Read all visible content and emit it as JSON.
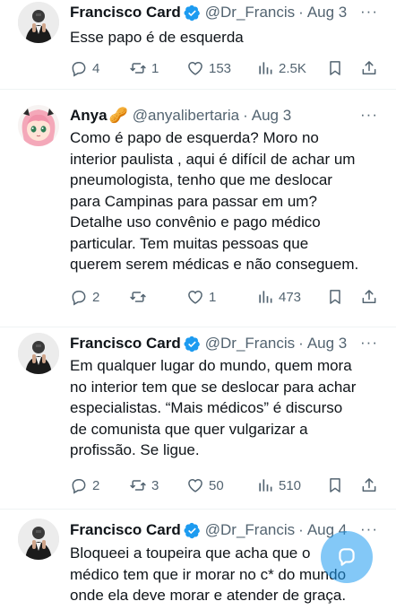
{
  "tweets": [
    {
      "name": "Francisco Card",
      "handle": "@Dr_Francis",
      "dot": "·",
      "date": "Aug 3",
      "more": "···",
      "lines": [
        "Esse papo é de esquerda"
      ],
      "replies": "4",
      "retweets": "1",
      "likes": "153",
      "views": "2.5K"
    },
    {
      "name": "Anya",
      "name_emoji": "🥜",
      "handle": "@anyalibertaria",
      "dot": "·",
      "date": "Aug 3",
      "more": "···",
      "lines": [
        "Como é papo de esquerda? Moro no",
        "interior paulista , aqui é difícil de achar um",
        "pneumologista, tenho que me deslocar",
        "para Campinas para passar em um?",
        "Detalhe uso convênio e pago médico",
        "particular. Tem muitas pessoas que",
        "querem serem médicas e não conseguem."
      ],
      "replies": "2",
      "retweets": "",
      "likes": "1",
      "views": "473"
    },
    {
      "name": "Francisco Card",
      "handle": "@Dr_Francis",
      "dot": "·",
      "date": "Aug 3",
      "more": "···",
      "lines": [
        "Em qualquer lugar do mundo, quem mora",
        "no interior tem que se deslocar para achar",
        "especialistas. “Mais médicos” é discurso",
        "de comunista que quer vulgarizar a",
        "profissão. Se ligue."
      ],
      "replies": "2",
      "retweets": "3",
      "likes": "50",
      "views": "510"
    },
    {
      "name": "Francisco Card",
      "handle": "@Dr_Francis",
      "dot": "·",
      "date": "Aug 4",
      "more": "···",
      "lines": [
        "Bloqueei a toupeira que acha que o",
        "médico tem que ir morar no c* do mundo",
        "onde ela deve morar e atender de graça."
      ]
    }
  ],
  "colors": {
    "text": "#0f1419",
    "secondary": "#536471",
    "verified_blue": "#1d9bf0",
    "divider": "#eff3f4"
  },
  "icons": [
    "reply-icon",
    "retweet-icon",
    "like-icon",
    "views-icon",
    "bookmark-icon",
    "share-icon",
    "verified-badge-icon",
    "compose-icon"
  ]
}
